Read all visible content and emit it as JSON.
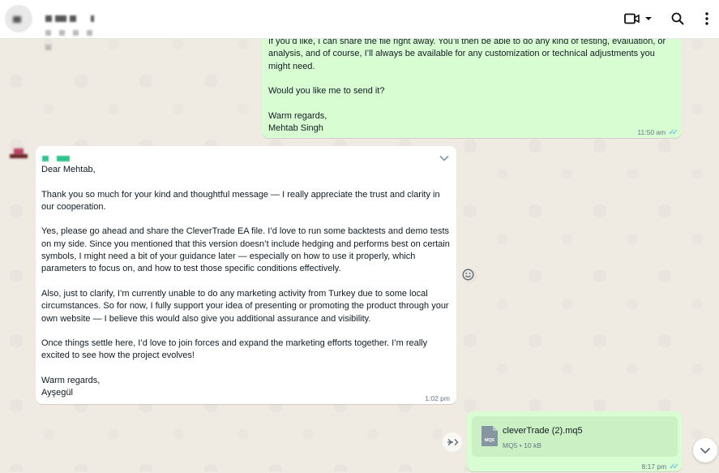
{
  "header": {
    "icons": [
      "video-call-icon",
      "chevron-down-icon",
      "search-icon",
      "menu-icon"
    ]
  },
  "messages": [
    {
      "direction": "outgoing",
      "paragraphs": [
        "If you’d like, I can share the file right away. You’ll then be able to do any kind of testing, evaluation, or analysis, and of course, I’ll always be available for any customization or technical adjustments you might need.",
        "Would you like me to send it?",
        "Warm regards,\nMehtab Singh"
      ],
      "time": "11:50 am",
      "status": "read"
    },
    {
      "direction": "incoming",
      "paragraphs": [
        "Dear Mehtab,",
        "Thank you so much for your kind and thoughtful message — I really appreciate the trust and clarity in our cooperation.",
        "Yes, please go ahead and share the CleverTrade EA file. I’d love to run some backtests and demo tests on my side. Since you mentioned that this version doesn’t include hedging and performs best on certain symbols, I might need a bit of your guidance later — especially on how to use it properly, which parameters to focus on, and how to test those specific conditions effectively.",
        "Also, just to clarify, I’m currently unable to do any marketing activity from Turkey due to some local circumstances. So for now, I fully support your idea of presenting or promoting the product through your own website — I believe this would also give you additional assurance and visibility.",
        "Once things settle here, I’d love to join forces and expand the marketing efforts together. I’m really excited to see how the project evolves!",
        "Warm regards,\nAyşegül"
      ],
      "time": "1:02 pm"
    },
    {
      "direction": "outgoing",
      "file": {
        "name": "cleverTrade (2).mq5",
        "type": "MQ5",
        "size": "10 kB",
        "icon_text": "MQ5"
      },
      "time": "8:17 pm",
      "status": "read"
    }
  ],
  "colors": {
    "outgoing_bubble": "#d9fdd3",
    "incoming_bubble": "#ffffff",
    "chat_background": "#efeae2",
    "read_ticks": "#53bdeb"
  }
}
